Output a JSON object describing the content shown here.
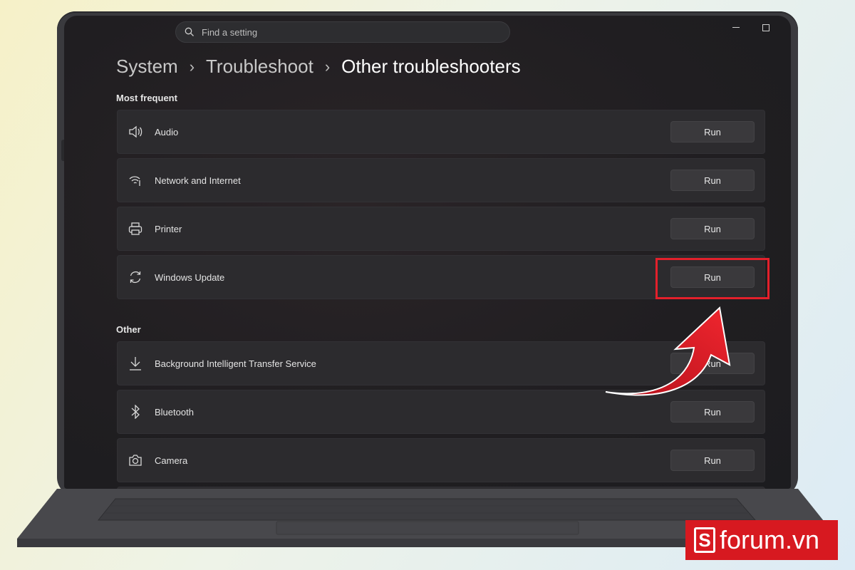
{
  "search": {
    "placeholder": "Find a setting"
  },
  "breadcrumb": {
    "items": [
      "System",
      "Troubleshoot"
    ],
    "current": "Other troubleshooters"
  },
  "sections": {
    "most_frequent": "Most frequent",
    "other": "Other"
  },
  "most_frequent_items": [
    {
      "label": "Audio",
      "icon": "speaker-icon",
      "button": "Run"
    },
    {
      "label": "Network and Internet",
      "icon": "wifi-icon",
      "button": "Run"
    },
    {
      "label": "Printer",
      "icon": "printer-icon",
      "button": "Run"
    },
    {
      "label": "Windows Update",
      "icon": "sync-icon",
      "button": "Run"
    }
  ],
  "other_items": [
    {
      "label": "Background Intelligent Transfer Service",
      "icon": "download-icon",
      "button": "Run"
    },
    {
      "label": "Bluetooth",
      "icon": "bluetooth-icon",
      "button": "Run"
    },
    {
      "label": "Camera",
      "icon": "camera-icon",
      "button": "Run"
    }
  ],
  "brand": {
    "letter": "S",
    "text": "forum.vn",
    "color": "#d71920"
  },
  "colors": {
    "highlight": "#e3202b",
    "arrow": "#e3202b"
  }
}
